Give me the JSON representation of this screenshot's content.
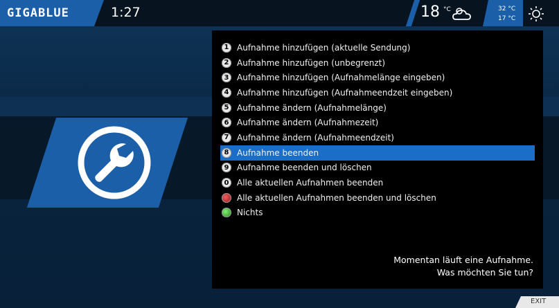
{
  "header": {
    "logo": "GIGABLUE",
    "clock": "1:27",
    "temperature": "18",
    "temperature_unit": "°C",
    "temp_max": "32 °C",
    "temp_min": "17 °C",
    "weather_icon": "cloudy-icon",
    "sun_icon": "sun-icon"
  },
  "menu": {
    "items": [
      {
        "key": "1",
        "label": "Aufnahme hinzufügen (aktuelle Sendung)"
      },
      {
        "key": "2",
        "label": "Aufnahme hinzufügen (unbegrenzt)"
      },
      {
        "key": "3",
        "label": "Aufnahme hinzufügen (Aufnahmelänge eingeben)"
      },
      {
        "key": "4",
        "label": "Aufnahme hinzufügen (Aufnahmeendzeit eingeben)"
      },
      {
        "key": "5",
        "label": "Aufnahme ändern (Aufnahmelänge)"
      },
      {
        "key": "6",
        "label": "Aufnahme ändern (Aufnahmezeit)"
      },
      {
        "key": "7",
        "label": "Aufnahme ändern (Aufnahmeendzeit)"
      },
      {
        "key": "8",
        "label": "Aufnahme beenden"
      },
      {
        "key": "9",
        "label": "Aufnahme beenden und löschen"
      },
      {
        "key": "0",
        "label": "Alle aktuellen Aufnahmen beenden"
      },
      {
        "key": "red",
        "label": "Alle aktuellen Aufnahmen beenden und löschen"
      },
      {
        "key": "green",
        "label": "Nichts"
      }
    ],
    "selected_index": 7
  },
  "message": {
    "line1": "Momentan läuft eine Aufnahme.",
    "line2": "Was möchten Sie tun?"
  },
  "footer": {
    "exit_label": "EXIT"
  },
  "colors": {
    "accent": "#1a5fa8",
    "selected": "#1a6ec7"
  }
}
